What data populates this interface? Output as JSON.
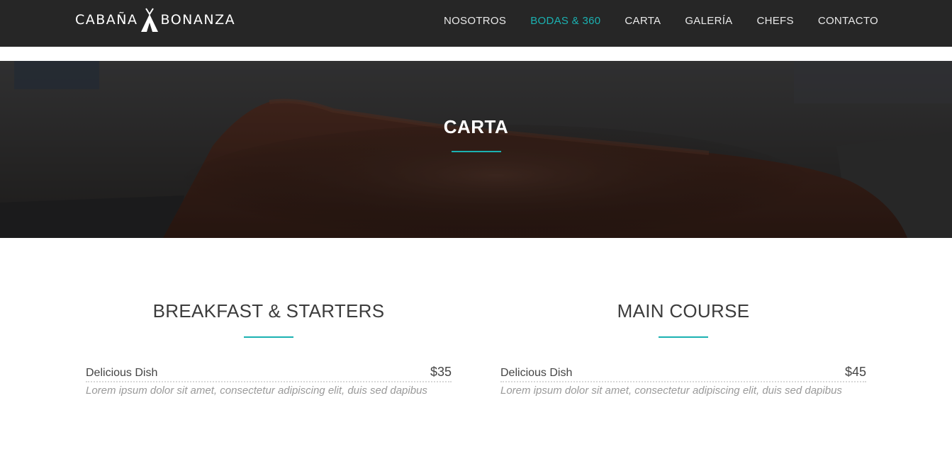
{
  "brand": {
    "name_left": "CABAÑA",
    "name_right": "BONANZA"
  },
  "nav": {
    "items": [
      {
        "label": "NOSOTROS"
      },
      {
        "label": "BODAS & 360"
      },
      {
        "label": "CARTA"
      },
      {
        "label": "GALERÍA"
      },
      {
        "label": "CHEFS"
      },
      {
        "label": "CONTACTO"
      }
    ],
    "active_index": 1
  },
  "hero": {
    "title": "CARTA"
  },
  "sections": [
    {
      "title": "BREAKFAST & STARTERS",
      "items": [
        {
          "name": "Delicious Dish",
          "price": "$35",
          "description": "Lorem ipsum dolor sit amet, consectetur adipiscing elit, duis sed dapibus"
        }
      ]
    },
    {
      "title": "MAIN COURSE",
      "items": [
        {
          "name": "Delicious Dish",
          "price": "$45",
          "description": "Lorem ipsum dolor sit amet, consectetur adipiscing elit, duis sed dapibus"
        }
      ]
    }
  ],
  "colors": {
    "accent": "#1bb1b1",
    "navbar": "#262626",
    "text": "#3c3c3c"
  }
}
